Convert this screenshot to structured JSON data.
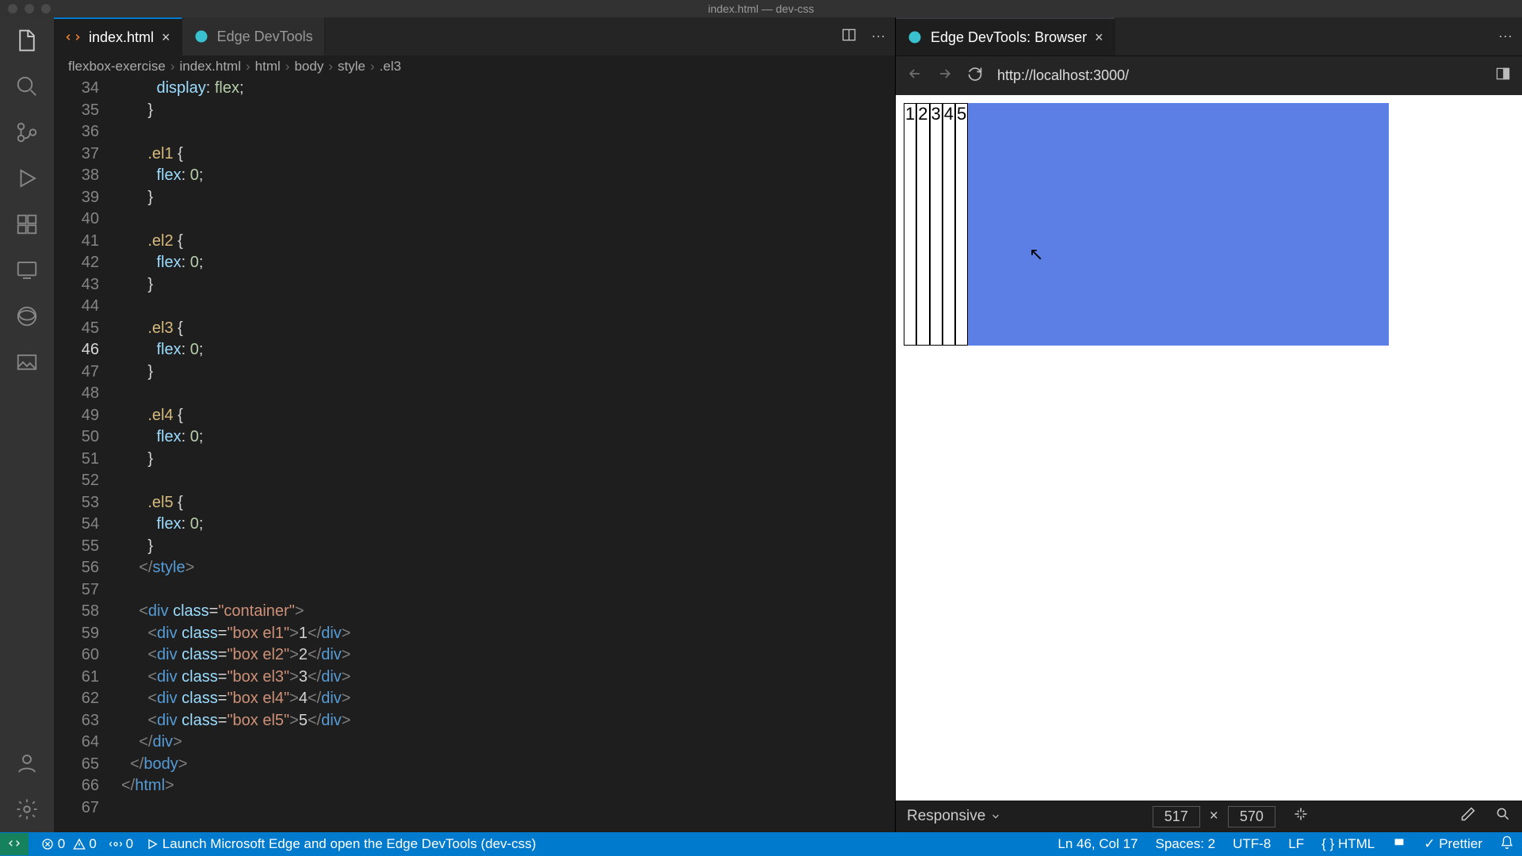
{
  "window_title": "index.html — dev-css",
  "tabs_editor": {
    "t1": {
      "label": "index.html"
    },
    "t2": {
      "label": "Edge DevTools"
    }
  },
  "tabs_browser": {
    "t1": {
      "label": "Edge DevTools: Browser"
    }
  },
  "breadcrumb": [
    "flexbox-exercise",
    "index.html",
    "html",
    "body",
    "style",
    ".el3"
  ],
  "code": {
    "lines": [
      {
        "n": 34,
        "kind": "css",
        "indent": 4,
        "prop": "display",
        "val": "flex"
      },
      {
        "n": 35,
        "kind": "close",
        "indent": 3
      },
      {
        "n": 36,
        "kind": "blank"
      },
      {
        "n": 37,
        "kind": "sel",
        "indent": 3,
        "sel": ".el1"
      },
      {
        "n": 38,
        "kind": "css",
        "indent": 4,
        "prop": "flex",
        "val": "0"
      },
      {
        "n": 39,
        "kind": "close",
        "indent": 3
      },
      {
        "n": 40,
        "kind": "blank"
      },
      {
        "n": 41,
        "kind": "sel",
        "indent": 3,
        "sel": ".el2"
      },
      {
        "n": 42,
        "kind": "css",
        "indent": 4,
        "prop": "flex",
        "val": "0"
      },
      {
        "n": 43,
        "kind": "close",
        "indent": 3
      },
      {
        "n": 44,
        "kind": "blank"
      },
      {
        "n": 45,
        "kind": "sel",
        "indent": 3,
        "sel": ".el3"
      },
      {
        "n": 46,
        "kind": "css",
        "indent": 4,
        "prop": "flex",
        "val": "0",
        "cur": true
      },
      {
        "n": 47,
        "kind": "close",
        "indent": 3
      },
      {
        "n": 48,
        "kind": "blank"
      },
      {
        "n": 49,
        "kind": "sel",
        "indent": 3,
        "sel": ".el4"
      },
      {
        "n": 50,
        "kind": "css",
        "indent": 4,
        "prop": "flex",
        "val": "0"
      },
      {
        "n": 51,
        "kind": "close",
        "indent": 3
      },
      {
        "n": 52,
        "kind": "blank"
      },
      {
        "n": 53,
        "kind": "sel",
        "indent": 3,
        "sel": ".el5"
      },
      {
        "n": 54,
        "kind": "css",
        "indent": 4,
        "prop": "flex",
        "val": "0"
      },
      {
        "n": 55,
        "kind": "close",
        "indent": 3
      },
      {
        "n": 56,
        "kind": "closetag",
        "indent": 2,
        "tag": "style"
      },
      {
        "n": 57,
        "kind": "blank"
      },
      {
        "n": 58,
        "kind": "opentag",
        "indent": 2,
        "tag": "div",
        "attrs": [
          [
            "class",
            "container"
          ]
        ]
      },
      {
        "n": 59,
        "kind": "fulltag",
        "indent": 3,
        "tag": "div",
        "attrs": [
          [
            "class",
            "box el1"
          ]
        ],
        "text": "1"
      },
      {
        "n": 60,
        "kind": "fulltag",
        "indent": 3,
        "tag": "div",
        "attrs": [
          [
            "class",
            "box el2"
          ]
        ],
        "text": "2"
      },
      {
        "n": 61,
        "kind": "fulltag",
        "indent": 3,
        "tag": "div",
        "attrs": [
          [
            "class",
            "box el3"
          ]
        ],
        "text": "3"
      },
      {
        "n": 62,
        "kind": "fulltag",
        "indent": 3,
        "tag": "div",
        "attrs": [
          [
            "class",
            "box el4"
          ]
        ],
        "text": "4"
      },
      {
        "n": 63,
        "kind": "fulltag",
        "indent": 3,
        "tag": "div",
        "attrs": [
          [
            "class",
            "box el5"
          ]
        ],
        "text": "5"
      },
      {
        "n": 64,
        "kind": "closetag",
        "indent": 2,
        "tag": "div"
      },
      {
        "n": 65,
        "kind": "closetag",
        "indent": 1,
        "tag": "body"
      },
      {
        "n": 66,
        "kind": "closetag",
        "indent": 0,
        "tag": "html"
      },
      {
        "n": 67,
        "kind": "blank"
      }
    ]
  },
  "url": "http://localhost:3000/",
  "device": {
    "mode": "Responsive",
    "w": "517",
    "h": "570"
  },
  "status": {
    "errors": "0",
    "warnings": "0",
    "ports": "0",
    "launch": "Launch Microsoft Edge and open the Edge DevTools (dev-css)",
    "cursor": "Ln 46, Col 17",
    "spaces": "Spaces: 2",
    "encoding": "UTF-8",
    "eol": "LF",
    "lang": "HTML",
    "prettier": "Prettier"
  },
  "preview_items": [
    "1",
    "2",
    "3",
    "4",
    "5"
  ]
}
